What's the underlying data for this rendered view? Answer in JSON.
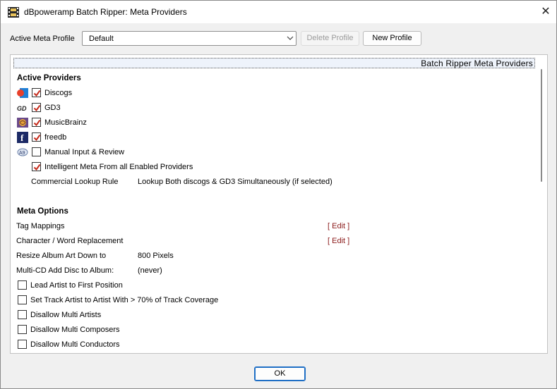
{
  "window": {
    "title": "dBpoweramp Batch Ripper: Meta Providers"
  },
  "profile": {
    "label": "Active Meta Profile",
    "selected": "Default",
    "delete_label": "Delete Profile",
    "new_label": "New Profile"
  },
  "panel": {
    "header": "Batch Ripper Meta Providers",
    "active_title": "Active Providers",
    "providers": [
      {
        "name": "Discogs",
        "checked": true,
        "icon": "discogs-icon"
      },
      {
        "name": "GD3",
        "checked": true,
        "icon": "gd3-icon"
      },
      {
        "name": "MusicBrainz",
        "checked": true,
        "icon": "musicbrainz-icon"
      },
      {
        "name": "freedb",
        "checked": true,
        "icon": "freedb-icon"
      },
      {
        "name": "Manual Input & Review",
        "checked": false,
        "icon": "manual-input-icon"
      }
    ],
    "intelligent": {
      "label": "Intelligent Meta From all Enabled Providers",
      "checked": true
    },
    "commercial": {
      "label": "Commercial Lookup Rule",
      "value": "Lookup Both discogs & GD3 Simultaneously (if selected)"
    },
    "meta_title": "Meta Options",
    "tag_mappings": {
      "label": "Tag Mappings",
      "edit": "[ Edit ]"
    },
    "char_replace": {
      "label": "Character / Word Replacement",
      "edit": "[ Edit ]"
    },
    "resize_art": {
      "label": "Resize Album Art Down to",
      "value": "800 Pixels"
    },
    "multi_cd": {
      "label": "Multi-CD Add Disc to Album:",
      "value": "(never)"
    },
    "options": [
      {
        "label": "Lead Artist to First Position",
        "checked": false
      },
      {
        "label": "Set Track Artist to Artist With > 70% of Track Coverage",
        "checked": false
      },
      {
        "label": "Disallow Multi Artists",
        "checked": false
      },
      {
        "label": "Disallow Multi Composers",
        "checked": false
      },
      {
        "label": "Disallow Multi Conductors",
        "checked": false
      }
    ]
  },
  "footer": {
    "ok_label": "OK"
  },
  "colors": {
    "accent": "#1f6fc5",
    "edit_link": "#8b1a1a",
    "check": "#c42b1c"
  }
}
